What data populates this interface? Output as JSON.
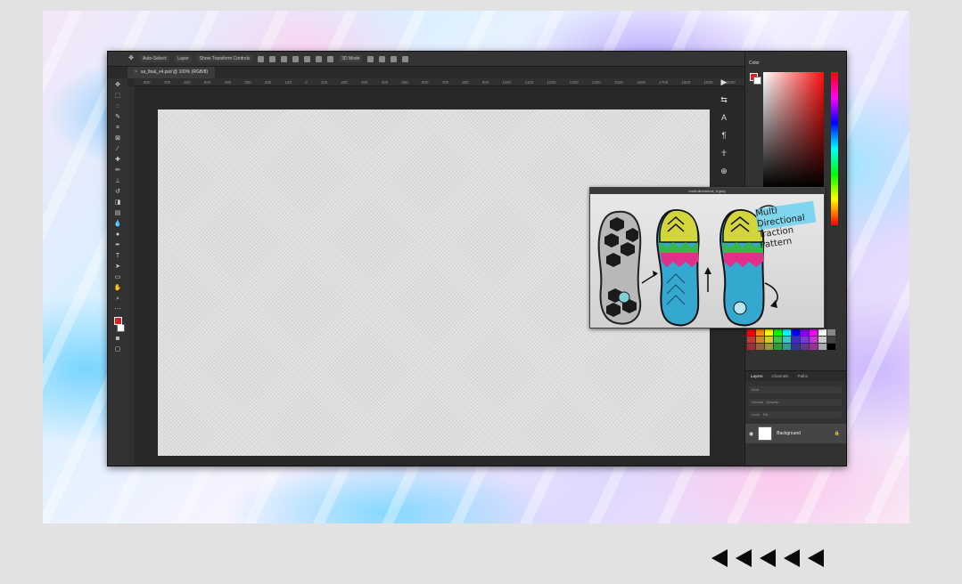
{
  "app": {
    "options_bar": {
      "auto_select_label": "Auto-Select:",
      "auto_select_value": "Layer",
      "show_transform_controls": "Show Transform Controls",
      "mode_3d": "3D Mode"
    },
    "document_tab": "sa_final_v4.psd @ 100% (RGB/8)",
    "ruler_ticks": [
      "800",
      "700",
      "600",
      "500",
      "400",
      "300",
      "200",
      "100",
      "0",
      "100",
      "200",
      "300",
      "400",
      "500",
      "600",
      "700",
      "800",
      "900",
      "1000",
      "1100",
      "1200",
      "1300",
      "1400",
      "1500",
      "1600",
      "1700",
      "1800",
      "1900",
      "2000"
    ],
    "panels": {
      "color_tab": "Color",
      "layers_tabs": [
        "Layers",
        "Channels",
        "Paths"
      ],
      "layer_filter": "Kind",
      "layer_blend": "Normal",
      "layer_opacity_label": "Opacity:",
      "layer_lock_label": "Lock:",
      "layer_fill_label": "Fill:",
      "background_layer": "Background"
    },
    "foreground_color": "#e02020",
    "background_color": "#ffffff"
  },
  "reference_window": {
    "title": "multi-directional_tf.jpeg",
    "note_lines": [
      "Multi",
      "Directional",
      "Traction",
      "Pattern"
    ]
  },
  "nav": {
    "arrows": [
      "back-arrow-icon",
      "back-arrow-icon",
      "back-arrow-icon",
      "back-arrow-icon",
      "back-arrow-icon"
    ]
  }
}
